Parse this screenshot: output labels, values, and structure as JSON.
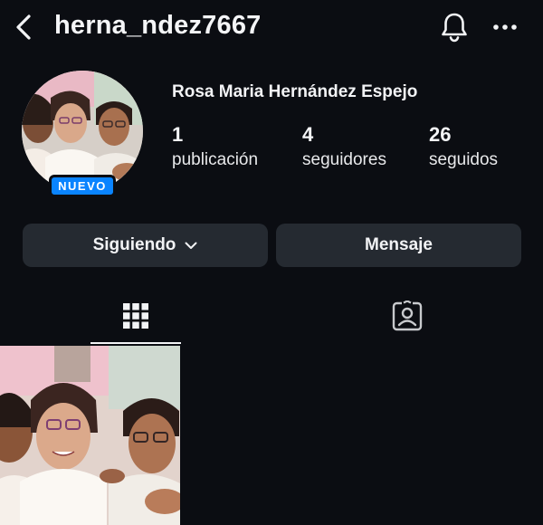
{
  "header": {
    "username": "herna_ndez7667",
    "icons": [
      "chevron-left-icon",
      "bell-icon",
      "more-horizontal-icon"
    ]
  },
  "profile": {
    "full_name": "Rosa Maria Hernández Espejo",
    "badge": "NUEVO",
    "stats": {
      "posts": {
        "value": "1",
        "label": "publicación"
      },
      "followers": {
        "value": "4",
        "label": "seguidores"
      },
      "following": {
        "value": "26",
        "label": "seguidos"
      }
    }
  },
  "actions": {
    "following_label": "Siguiendo",
    "message_label": "Mensaje"
  },
  "tabs": [
    {
      "icon": "grid-icon",
      "active": true
    },
    {
      "icon": "tagged-person-icon",
      "active": false
    }
  ],
  "posts_count_shown": 1,
  "colors": {
    "background": "#0b0d12",
    "button": "#252a31",
    "badge": "#0a84ff",
    "text": "#f2f3f5"
  }
}
